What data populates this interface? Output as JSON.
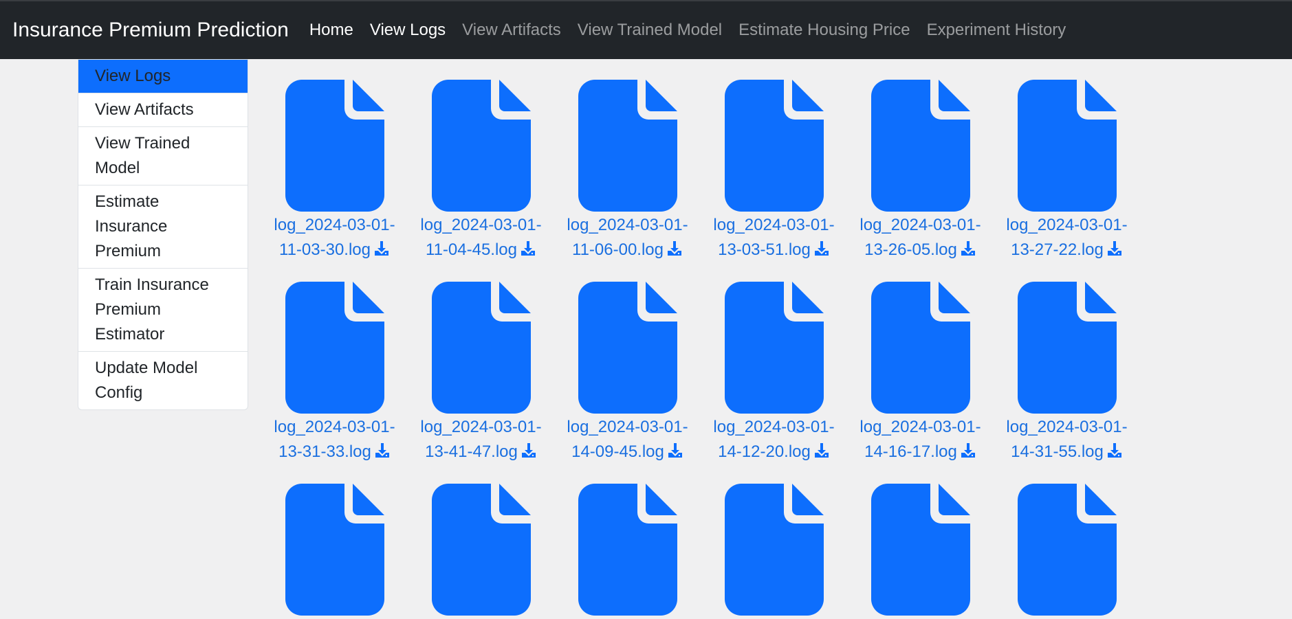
{
  "navbar": {
    "brand": "Insurance Premium Prediction",
    "links": [
      {
        "label": "Home",
        "active": true
      },
      {
        "label": "View Logs",
        "active": true
      },
      {
        "label": "View Artifacts",
        "active": false
      },
      {
        "label": "View Trained Model",
        "active": false
      },
      {
        "label": "Estimate Housing Price",
        "active": false
      },
      {
        "label": "Experiment History",
        "active": false
      }
    ]
  },
  "sidebar": {
    "items": [
      {
        "label": "View Logs",
        "active": true
      },
      {
        "label": "View Artifacts",
        "active": false
      },
      {
        "label": "View Trained Model",
        "active": false
      },
      {
        "label": "Estimate Insurance Premium",
        "active": false
      },
      {
        "label": "Train Insurance Premium Estimator",
        "active": false
      },
      {
        "label": "Update Model Config",
        "active": false
      }
    ]
  },
  "files": {
    "icon": "file-icon",
    "download_icon": "download-icon",
    "accent": "#0d6efd",
    "items": [
      {
        "line1": "log_2024-03-01-",
        "line2": "11-03-30.log"
      },
      {
        "line1": "log_2024-03-01-",
        "line2": "11-04-45.log"
      },
      {
        "line1": "log_2024-03-01-",
        "line2": "11-06-00.log"
      },
      {
        "line1": "log_2024-03-01-",
        "line2": "13-03-51.log"
      },
      {
        "line1": "log_2024-03-01-",
        "line2": "13-26-05.log"
      },
      {
        "line1": "log_2024-03-01-",
        "line2": "13-27-22.log"
      },
      {
        "line1": "log_2024-03-01-",
        "line2": "13-31-33.log"
      },
      {
        "line1": "log_2024-03-01-",
        "line2": "13-41-47.log"
      },
      {
        "line1": "log_2024-03-01-",
        "line2": "14-09-45.log"
      },
      {
        "line1": "log_2024-03-01-",
        "line2": "14-12-20.log"
      },
      {
        "line1": "log_2024-03-01-",
        "line2": "14-16-17.log"
      },
      {
        "line1": "log_2024-03-01-",
        "line2": "14-31-55.log"
      },
      {
        "line1": "",
        "line2": ""
      },
      {
        "line1": "",
        "line2": ""
      },
      {
        "line1": "",
        "line2": ""
      },
      {
        "line1": "",
        "line2": ""
      },
      {
        "line1": "",
        "line2": ""
      },
      {
        "line1": "",
        "line2": ""
      }
    ]
  }
}
